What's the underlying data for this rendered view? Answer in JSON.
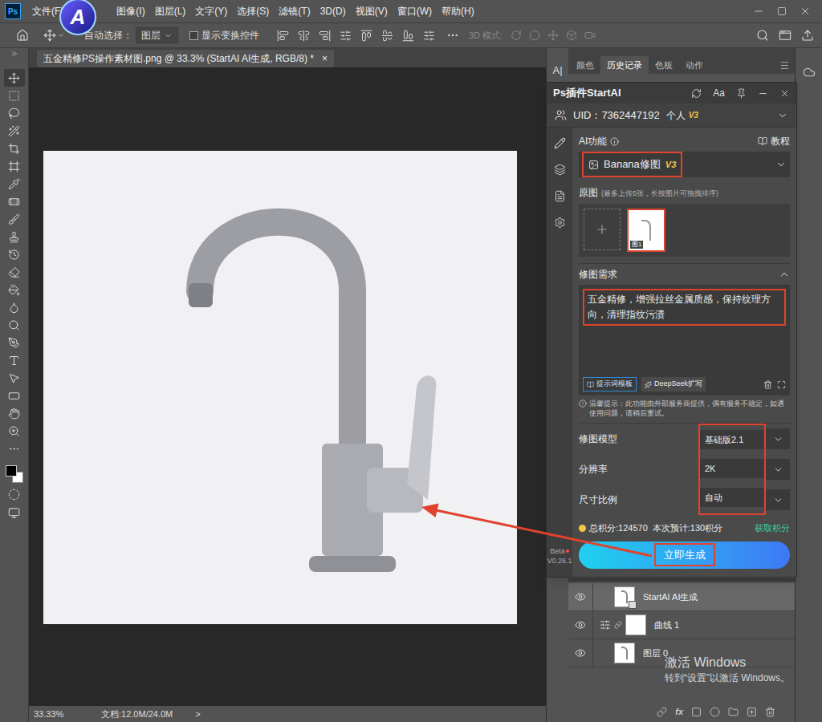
{
  "app": {
    "logo": "Ps",
    "plugin_logo": "A"
  },
  "menu": [
    "文件(F)",
    "图像(I)",
    "图层(L)",
    "文字(Y)",
    "选择(S)",
    "滤镜(T)",
    "3D(D)",
    "视图(V)",
    "窗口(W)",
    "帮助(H)"
  ],
  "options_bar": {
    "auto_select_label": "自动选择：",
    "auto_select_value": "图层",
    "show_transform": {
      "label": "显示变换控件",
      "checked": false
    },
    "mode_label": "3D 模式:"
  },
  "document_tab": {
    "title": "五金精修PS操作素材图.png @ 33.3% (StartAI AI生成, RGB/8) *",
    "close": "×"
  },
  "status_bar": {
    "zoom": "33.33%",
    "doc": "文档:12.0M/24.0M",
    "arrow": ">"
  },
  "panel_tabs": [
    {
      "label": "颜色",
      "selected": false
    },
    {
      "label": "历史记录",
      "selected": true
    },
    {
      "label": "色板",
      "selected": false
    },
    {
      "label": "动作",
      "selected": false
    }
  ],
  "plugin": {
    "dock_label": "A|",
    "title": "Ps插件StartAI",
    "font_button": "Aa",
    "uid": "UID：7362447192",
    "plan": "个人",
    "plan_badge": "V3",
    "ai_label": "AI功能",
    "tutorial": "教程",
    "function": {
      "name": "Banana修图",
      "badge": "V3",
      "highlighted": true
    },
    "source": {
      "label": "原图",
      "hint": "(最多上传5张，长按图片可拖拽排序)",
      "images": [
        {
          "label": "图1",
          "highlighted": true
        }
      ]
    },
    "prompt": {
      "label": "修图需求",
      "expanded": true,
      "text": "五金精修，增强拉丝金属质感，保持纹理方向，清理指纹污渍",
      "highlighted": true,
      "template_button": "提示词模板",
      "expand_button": "DeepSeek扩写"
    },
    "notice": "温馨提示：此功能由外部服务商提供，偶有服务不稳定，如遇使用问题，请稍后重试。",
    "settings": {
      "highlighted": true,
      "rows": [
        {
          "label": "修图模型",
          "value": "基础版2.1"
        },
        {
          "label": "分辨率",
          "value": "2K"
        },
        {
          "label": "尺寸比例",
          "value": "自动"
        }
      ]
    },
    "points": {
      "total": "总积分:124570",
      "estimate": "本次预计:130积分",
      "get": "获取积分"
    },
    "generate": {
      "label": "立即生成",
      "highlighted": true
    },
    "beta": "Beta",
    "version": "V0.26.1"
  },
  "layers": [
    {
      "name": "StartAI AI生成",
      "selected": true,
      "visible": true,
      "kind": "smart"
    },
    {
      "name": "曲线 1",
      "selected": false,
      "visible": true,
      "kind": "adjustment"
    },
    {
      "name": "图层 0",
      "selected": false,
      "visible": true,
      "kind": "image"
    }
  ],
  "layer_toolbar": {
    "fx": "fx"
  },
  "watermark": {
    "title": "激活 Windows",
    "subtitle": "转到“设置”以激活 Windows。"
  }
}
